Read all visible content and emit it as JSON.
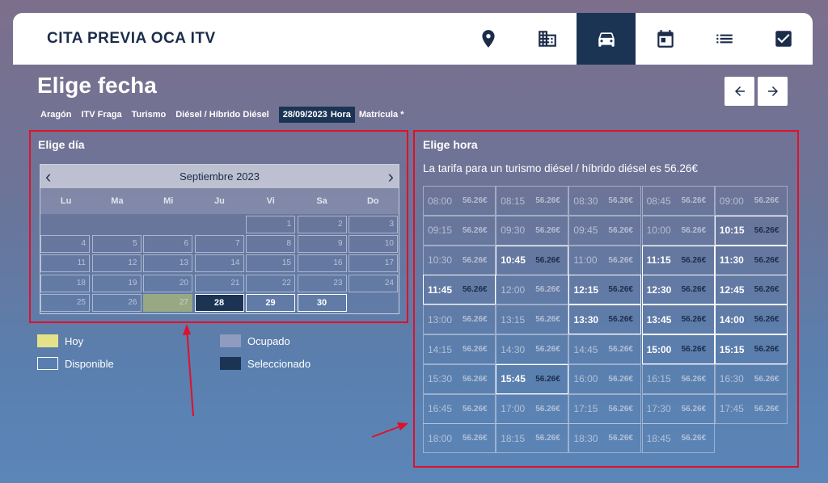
{
  "brand": "CITA PREVIA OCA ITV",
  "nav": [
    "location-icon",
    "building-icon",
    "car-icon",
    "calendar-icon",
    "list-icon",
    "checkbox-icon"
  ],
  "title": "Elige fecha",
  "breadcrumb": {
    "items": [
      "Aragón",
      "ITV Fraga",
      "Turismo",
      "Diésel / Híbrido Diésel"
    ],
    "active_date": "28/09/2023",
    "active_hora": "Hora",
    "after": "Matrícula *"
  },
  "calendar": {
    "section_title": "Elige día",
    "month": "Septiembre 2023",
    "weekdays": [
      "Lu",
      "Ma",
      "Mi",
      "Ju",
      "Vi",
      "Sa",
      "Do"
    ]
  },
  "legend": {
    "hoy": "Hoy",
    "disponible": "Disponible",
    "ocupado": "Ocupado",
    "seleccionado": "Seleccionado"
  },
  "hours": {
    "section_title": "Elige hora",
    "tarifa": "La tarifa para un turismo diésel / híbrido diésel es 56.26€",
    "price": "56.26€"
  },
  "colors": {
    "accent": "#1b3454",
    "today": "#e3e28a",
    "occupied": "#8f9bbf",
    "highlight_box": "#e0102a"
  }
}
